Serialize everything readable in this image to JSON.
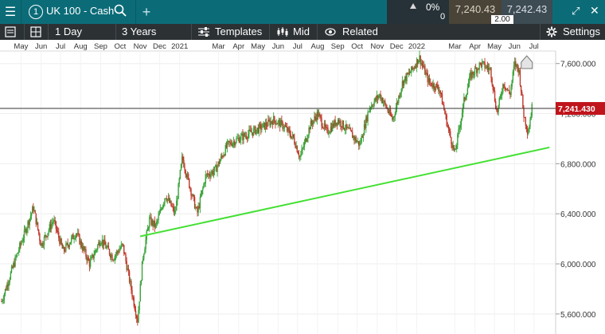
{
  "header": {
    "menu_icon": "hamburger-icon",
    "instrument_number": "1",
    "instrument_name": "UK 100 - Cash",
    "search_icon": "search-icon",
    "add_icon": "plus-icon",
    "change_percent": "0%",
    "volume": "0",
    "sell_price": "7,240.43",
    "spread": "2.00",
    "buy_price": "7,242.43",
    "expand_icon": "expand-icon",
    "close_icon": "close-icon"
  },
  "toolbar": {
    "interval": "1 Day",
    "range": "3 Years",
    "templates": "Templates",
    "price_mode": "Mid",
    "related": "Related",
    "settings": "Settings"
  },
  "chart_data": {
    "type": "candlestick",
    "y_ticks": [
      5600000,
      6000000,
      6400000,
      6800000,
      7200000,
      7600000
    ],
    "y_tick_labels": [
      "5,600.000",
      "6,000.000",
      "6,400.000",
      "6,800.000",
      "7,200.000",
      "7,600.000"
    ],
    "ylim": [
      5440,
      7700
    ],
    "x_ticks": [
      {
        "label": "May",
        "date": "2019-05-01"
      },
      {
        "label": "Jun",
        "date": "2019-06-01"
      },
      {
        "label": "Jul",
        "date": "2019-07-01"
      },
      {
        "label": "Aug",
        "date": "2019-08-01"
      },
      {
        "label": "Sep",
        "date": "2019-09-01"
      },
      {
        "label": "Oct",
        "date": "2019-10-01"
      },
      {
        "label": "Nov",
        "date": "2019-11-01"
      },
      {
        "label": "Dec",
        "date": "2019-12-01"
      },
      {
        "label": "2021",
        "date": "2020-01-01"
      },
      {
        "label": "Mar",
        "date": "2020-03-01"
      },
      {
        "label": "Apr",
        "date": "2020-04-01"
      },
      {
        "label": "May",
        "date": "2020-05-01"
      },
      {
        "label": "Jun",
        "date": "2020-06-01"
      },
      {
        "label": "Jul",
        "date": "2020-07-01"
      },
      {
        "label": "Aug",
        "date": "2020-08-01"
      },
      {
        "label": "Sep",
        "date": "2020-09-01"
      },
      {
        "label": "Oct",
        "date": "2020-10-01"
      },
      {
        "label": "Nov",
        "date": "2020-11-01"
      },
      {
        "label": "Dec",
        "date": "2020-12-01"
      },
      {
        "label": "2022",
        "date": "2021-01-01"
      },
      {
        "label": "Mar",
        "date": "2021-03-01"
      },
      {
        "label": "Apr",
        "date": "2021-04-01"
      },
      {
        "label": "May",
        "date": "2021-05-01"
      },
      {
        "label": "Jun",
        "date": "2021-06-01"
      },
      {
        "label": "Jul",
        "date": "2021-07-01"
      }
    ],
    "current_price": 7241.43,
    "current_price_label": "7,241.430",
    "trendline": {
      "start": {
        "date": "2019-11-01",
        "value": 6220
      },
      "end": {
        "date": "2021-07-25",
        "value": 6930
      }
    },
    "price_path": [
      {
        "date": "2019-04-01",
        "value": 5700
      },
      {
        "date": "2019-04-20",
        "value": 6000
      },
      {
        "date": "2019-05-10",
        "value": 6300
      },
      {
        "date": "2019-05-20",
        "value": 6450
      },
      {
        "date": "2019-06-01",
        "value": 6150
      },
      {
        "date": "2019-06-20",
        "value": 6350
      },
      {
        "date": "2019-07-05",
        "value": 6100
      },
      {
        "date": "2019-07-25",
        "value": 6250
      },
      {
        "date": "2019-08-15",
        "value": 6000
      },
      {
        "date": "2019-09-01",
        "value": 6200
      },
      {
        "date": "2019-09-20",
        "value": 6050
      },
      {
        "date": "2019-10-05",
        "value": 6150
      },
      {
        "date": "2019-10-20",
        "value": 5750
      },
      {
        "date": "2019-10-28",
        "value": 5550
      },
      {
        "date": "2019-11-05",
        "value": 6050
      },
      {
        "date": "2019-11-15",
        "value": 6350
      },
      {
        "date": "2019-11-25",
        "value": 6300
      },
      {
        "date": "2019-12-10",
        "value": 6550
      },
      {
        "date": "2019-12-25",
        "value": 6400
      },
      {
        "date": "2020-01-05",
        "value": 6850
      },
      {
        "date": "2020-01-15",
        "value": 6650
      },
      {
        "date": "2020-01-28",
        "value": 6400
      },
      {
        "date": "2020-02-10",
        "value": 6700
      },
      {
        "date": "2020-02-25",
        "value": 6750
      },
      {
        "date": "2020-03-15",
        "value": 6950
      },
      {
        "date": "2020-04-01",
        "value": 7000
      },
      {
        "date": "2020-04-20",
        "value": 7050
      },
      {
        "date": "2020-05-10",
        "value": 7100
      },
      {
        "date": "2020-05-25",
        "value": 7150
      },
      {
        "date": "2020-06-10",
        "value": 7100
      },
      {
        "date": "2020-06-25",
        "value": 7000
      },
      {
        "date": "2020-07-05",
        "value": 6850
      },
      {
        "date": "2020-07-20",
        "value": 7100
      },
      {
        "date": "2020-08-01",
        "value": 7200
      },
      {
        "date": "2020-08-15",
        "value": 7050
      },
      {
        "date": "2020-09-01",
        "value": 7150
      },
      {
        "date": "2020-09-20",
        "value": 7050
      },
      {
        "date": "2020-10-05",
        "value": 6950
      },
      {
        "date": "2020-10-20",
        "value": 7250
      },
      {
        "date": "2020-11-05",
        "value": 7350
      },
      {
        "date": "2020-11-25",
        "value": 7150
      },
      {
        "date": "2020-12-10",
        "value": 7450
      },
      {
        "date": "2020-12-25",
        "value": 7550
      },
      {
        "date": "2021-01-05",
        "value": 7650
      },
      {
        "date": "2021-01-20",
        "value": 7450
      },
      {
        "date": "2021-02-05",
        "value": 7400
      },
      {
        "date": "2021-02-20",
        "value": 7050
      },
      {
        "date": "2021-03-01",
        "value": 6880
      },
      {
        "date": "2021-03-15",
        "value": 7300
      },
      {
        "date": "2021-03-25",
        "value": 7500
      },
      {
        "date": "2021-04-10",
        "value": 7600
      },
      {
        "date": "2021-04-25",
        "value": 7550
      },
      {
        "date": "2021-05-05",
        "value": 7200
      },
      {
        "date": "2021-05-15",
        "value": 7450
      },
      {
        "date": "2021-05-25",
        "value": 7350
      },
      {
        "date": "2021-06-01",
        "value": 7600
      },
      {
        "date": "2021-06-08",
        "value": 7550
      },
      {
        "date": "2021-06-15",
        "value": 7200
      },
      {
        "date": "2021-06-22",
        "value": 7050
      },
      {
        "date": "2021-06-28",
        "value": 7250
      }
    ]
  }
}
